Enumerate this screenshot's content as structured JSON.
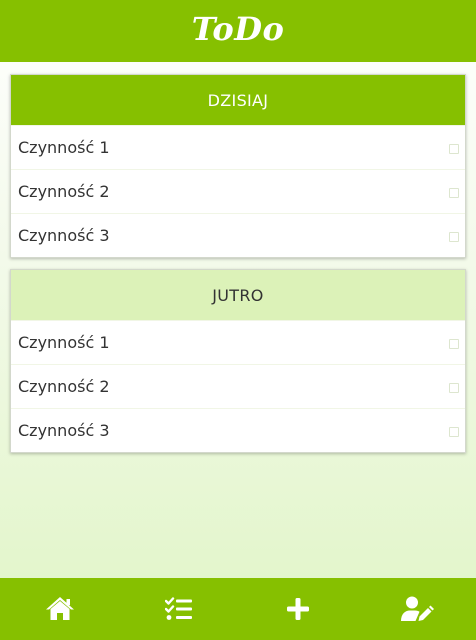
{
  "header": {
    "title": "ToDo"
  },
  "sections": [
    {
      "title": "DZISIAJ",
      "tasks": [
        {
          "label": "Czynność 1",
          "checked": false
        },
        {
          "label": "Czynność 2",
          "checked": false
        },
        {
          "label": "Czynność 3",
          "checked": false
        }
      ]
    },
    {
      "title": "JUTRO",
      "tasks": [
        {
          "label": "Czynność 1",
          "checked": false
        },
        {
          "label": "Czynność 2",
          "checked": false
        },
        {
          "label": "Czynność 3",
          "checked": false
        }
      ]
    }
  ],
  "tabbar": {
    "items": [
      {
        "icon": "home-icon"
      },
      {
        "icon": "task-list-icon"
      },
      {
        "icon": "plus-icon"
      },
      {
        "icon": "user-edit-icon"
      }
    ]
  },
  "colors": {
    "accent": "#86c000",
    "section_light": "#dcf2b8",
    "text": "#333333"
  }
}
